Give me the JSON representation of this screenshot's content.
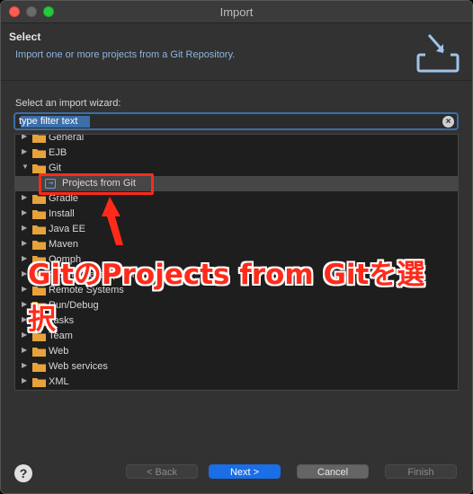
{
  "window": {
    "title": "Import"
  },
  "header": {
    "title": "Select",
    "description": "Import one or more projects from a Git Repository."
  },
  "wizard": {
    "label": "Select an import wizard:",
    "filter_value": "type filter text"
  },
  "tree": {
    "items": [
      {
        "label": "General",
        "expanded": false
      },
      {
        "label": "EJB",
        "expanded": false
      },
      {
        "label": "Git",
        "expanded": true
      },
      {
        "label": "Projects from Git",
        "child": true,
        "selected": true
      },
      {
        "label": "Gradle",
        "expanded": false
      },
      {
        "label": "Install",
        "expanded": false
      },
      {
        "label": "Java EE",
        "expanded": false
      },
      {
        "label": "Maven",
        "expanded": false
      },
      {
        "label": "Oomph",
        "expanded": false
      },
      {
        "label": "Plug-in Development",
        "expanded": false
      },
      {
        "label": "Remote Systems",
        "expanded": false
      },
      {
        "label": "Run/Debug",
        "expanded": false
      },
      {
        "label": "Tasks",
        "expanded": false
      },
      {
        "label": "Team",
        "expanded": false
      },
      {
        "label": "Web",
        "expanded": false
      },
      {
        "label": "Web services",
        "expanded": false
      },
      {
        "label": "XML",
        "expanded": false
      }
    ]
  },
  "annotation": {
    "text": "GitのProjects from Gitを選択",
    "color": "#ff2a1a"
  },
  "buttons": {
    "back": "< Back",
    "next": "Next >",
    "cancel": "Cancel",
    "finish": "Finish"
  },
  "colors": {
    "accent": "#1a6ee6",
    "folder": "#e8a23a"
  }
}
